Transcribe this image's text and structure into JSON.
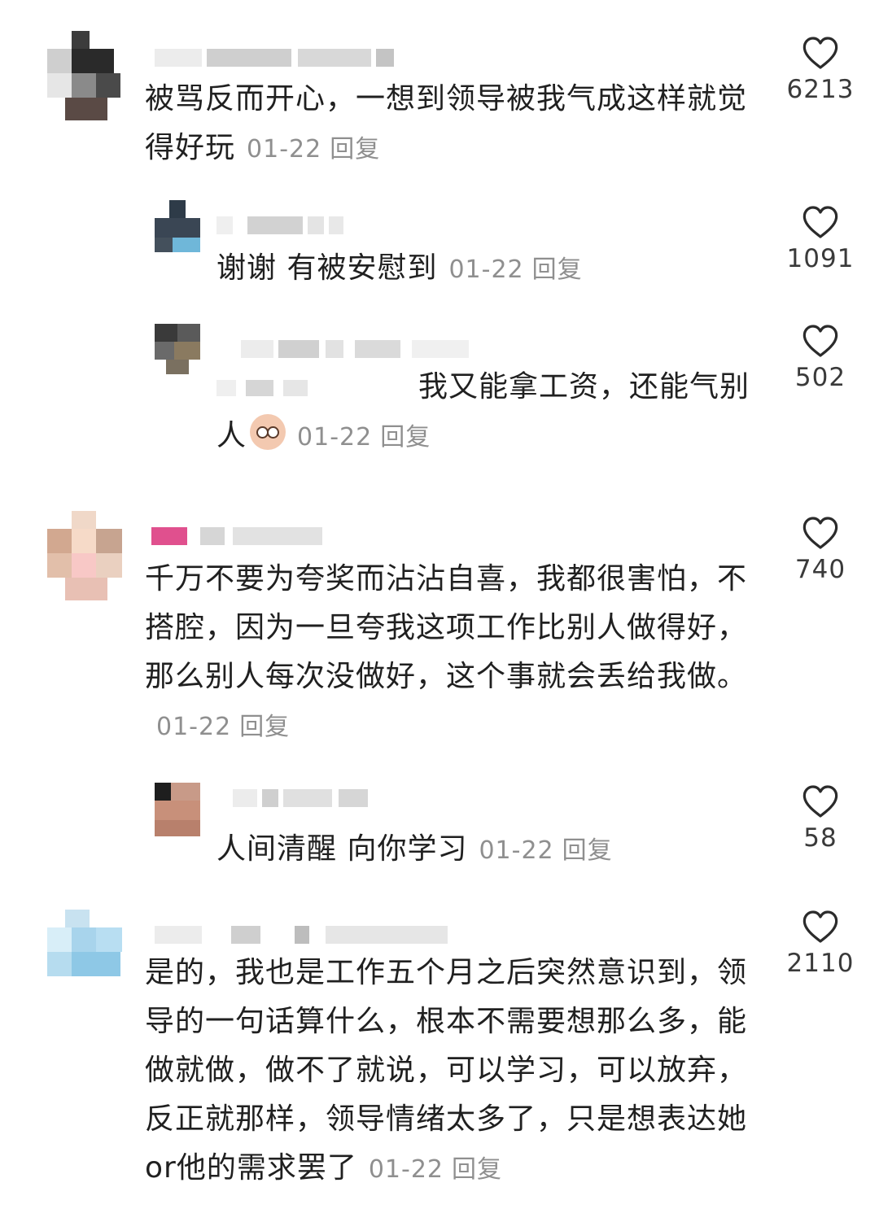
{
  "comments": [
    {
      "text": "被骂反而开心，一想到领导被我气成这样就觉得好玩",
      "date": "01-22",
      "reply": "回复",
      "likes": "6213",
      "replies": [
        {
          "text": "谢谢 有被安慰到",
          "date": "01-22",
          "reply": "回复",
          "likes": "1091"
        },
        {
          "text": "我又能拿工资，还能气别人",
          "date": "01-22",
          "reply": "回复",
          "likes": "502"
        }
      ]
    },
    {
      "text": "千万不要为夸奖而沾沾自喜，我都很害怕，不搭腔，因为一旦夸我这项工作比别人做得好，那么别人每次没做好，这个事就会丢给我做。",
      "date": "01-22",
      "reply": "回复",
      "likes": "740",
      "replies": [
        {
          "text": "人间清醒 向你学习",
          "date": "01-22",
          "reply": "回复",
          "likes": "58"
        }
      ]
    },
    {
      "text": "是的，我也是工作五个月之后突然意识到，领导的一句话算什么，根本不需要想那么多，能做就做，做不了就说，可以学习，可以放弃，反正就那样，领导情绪太多了，只是想表达她or他的需求罢了",
      "date": "01-22",
      "reply": "回复",
      "likes": "2110"
    }
  ],
  "colors": {
    "like_stroke": "#2b2b2b",
    "meta": "#8f8f8f"
  },
  "icons": {
    "like": "heart-outline-icon"
  }
}
